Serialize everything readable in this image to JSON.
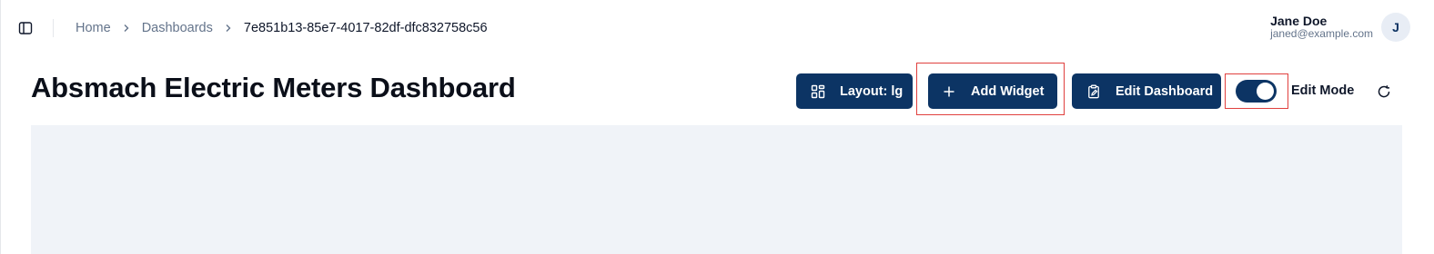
{
  "breadcrumb": {
    "items": [
      "Home",
      "Dashboards"
    ],
    "current": "7e851b13-85e7-4017-82df-dfc832758c56"
  },
  "user": {
    "name": "Jane Doe",
    "email": "janed@example.com",
    "initial": "J"
  },
  "page": {
    "title": "Absmach Electric Meters Dashboard"
  },
  "toolbar": {
    "layout_label": "Layout: lg",
    "add_widget_label": "Add Widget",
    "edit_dashboard_label": "Edit Dashboard",
    "edit_mode_label": "Edit Mode",
    "edit_mode_on": true
  },
  "icons": {
    "sidebar_toggle": "panel-left-icon",
    "breadcrumb_separator": "chevron-right-icon",
    "layout": "layout-grid-icon",
    "add": "plus-icon",
    "edit": "clipboard-pen-icon",
    "refresh": "refresh-icon"
  },
  "colors": {
    "primary": "#0c3464",
    "highlight": "#e0403e",
    "canvas": "#f0f3f8"
  }
}
